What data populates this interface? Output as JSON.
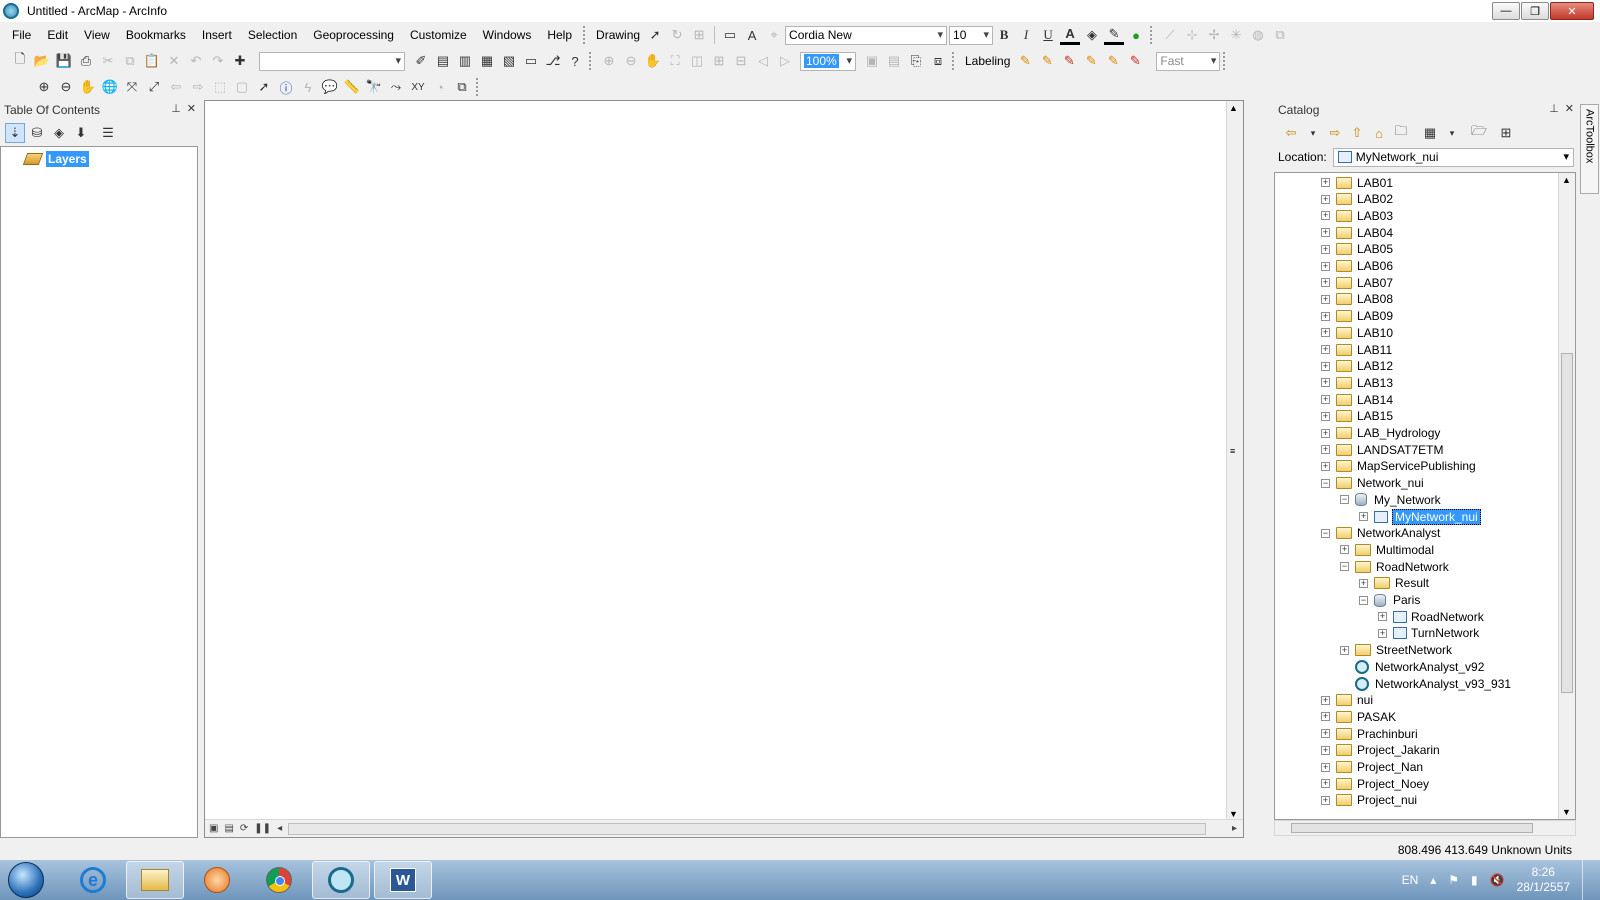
{
  "window": {
    "title": "Untitled - ArcMap - ArcInfo",
    "controls": [
      "—",
      "❐",
      "✕"
    ]
  },
  "menubar": [
    "File",
    "Edit",
    "View",
    "Bookmarks",
    "Insert",
    "Selection",
    "Geoprocessing",
    "Customize",
    "Windows",
    "Help"
  ],
  "drawing_toolbar": {
    "drawing_label": "Drawing",
    "font_name": "Cordia New",
    "font_size": "10",
    "bold": "B",
    "italic": "I",
    "underline": "U",
    "font_color_glyph": "A"
  },
  "standard_toolbar": {
    "scale_value": "",
    "zoom_value": "100%",
    "labeling_label": "Labeling",
    "quality_value": "Fast"
  },
  "toc": {
    "title": "Table Of Contents",
    "root_layer": "Layers"
  },
  "catalog": {
    "title": "Catalog",
    "location_label": "Location:",
    "location_value": "MyNetwork_nui",
    "tree": [
      {
        "label": "LAB01",
        "level": 0,
        "icon": "folder-icon",
        "expand": "+"
      },
      {
        "label": "LAB02",
        "level": 0,
        "icon": "folder-icon",
        "expand": "+"
      },
      {
        "label": "LAB03",
        "level": 0,
        "icon": "folder-icon",
        "expand": "+"
      },
      {
        "label": "LAB04",
        "level": 0,
        "icon": "folder-icon",
        "expand": "+"
      },
      {
        "label": "LAB05",
        "level": 0,
        "icon": "folder-icon",
        "expand": "+"
      },
      {
        "label": "LAB06",
        "level": 0,
        "icon": "folder-icon",
        "expand": "+"
      },
      {
        "label": "LAB07",
        "level": 0,
        "icon": "folder-icon",
        "expand": "+"
      },
      {
        "label": "LAB08",
        "level": 0,
        "icon": "folder-icon",
        "expand": "+"
      },
      {
        "label": "LAB09",
        "level": 0,
        "icon": "folder-icon",
        "expand": "+"
      },
      {
        "label": "LAB10",
        "level": 0,
        "icon": "folder-icon",
        "expand": "+"
      },
      {
        "label": "LAB11",
        "level": 0,
        "icon": "folder-icon",
        "expand": "+"
      },
      {
        "label": "LAB12",
        "level": 0,
        "icon": "folder-icon",
        "expand": "+"
      },
      {
        "label": "LAB13",
        "level": 0,
        "icon": "folder-icon",
        "expand": "+"
      },
      {
        "label": "LAB14",
        "level": 0,
        "icon": "folder-icon",
        "expand": "+"
      },
      {
        "label": "LAB15",
        "level": 0,
        "icon": "folder-icon",
        "expand": "+"
      },
      {
        "label": "LAB_Hydrology",
        "level": 0,
        "icon": "folder-icon",
        "expand": "+"
      },
      {
        "label": "LANDSAT7ETM",
        "level": 0,
        "icon": "folder-icon",
        "expand": "+"
      },
      {
        "label": "MapServicePublishing",
        "level": 0,
        "icon": "folder-icon",
        "expand": "+"
      },
      {
        "label": "Network_nui",
        "level": 0,
        "icon": "folder-icon",
        "expand": "−"
      },
      {
        "label": "My_Network",
        "level": 1,
        "icon": "gdb-icon",
        "expand": "−"
      },
      {
        "label": "MyNetwork_nui",
        "level": 2,
        "icon": "net-icon",
        "expand": "+",
        "selected": true
      },
      {
        "label": "NetworkAnalyst",
        "level": 0,
        "icon": "folder-icon",
        "expand": "−"
      },
      {
        "label": "Multimodal",
        "level": 1,
        "icon": "folder-icon",
        "expand": "+"
      },
      {
        "label": "RoadNetwork",
        "level": 1,
        "icon": "folder-icon",
        "expand": "−"
      },
      {
        "label": "Result",
        "level": 2,
        "icon": "folder-icon",
        "expand": "+"
      },
      {
        "label": "Paris",
        "level": 2,
        "icon": "gdb-icon",
        "expand": "−"
      },
      {
        "label": "RoadNetwork",
        "level": 3,
        "icon": "net-icon",
        "expand": "+"
      },
      {
        "label": "TurnNetwork",
        "level": 3,
        "icon": "net-icon",
        "expand": "+"
      },
      {
        "label": "StreetNetwork",
        "level": 1,
        "icon": "folder-icon",
        "expand": "+"
      },
      {
        "label": "NetworkAnalyst_v92",
        "level": 1,
        "icon": "mxd-icon",
        "expand": ""
      },
      {
        "label": "NetworkAnalyst_v93_931",
        "level": 1,
        "icon": "mxd-icon",
        "expand": ""
      },
      {
        "label": "nui",
        "level": 0,
        "icon": "folder-icon",
        "expand": "+"
      },
      {
        "label": "PASAK",
        "level": 0,
        "icon": "folder-icon",
        "expand": "+"
      },
      {
        "label": "Prachinburi",
        "level": 0,
        "icon": "folder-icon",
        "expand": "+"
      },
      {
        "label": "Project_Jakarin",
        "level": 0,
        "icon": "folder-icon",
        "expand": "+"
      },
      {
        "label": "Project_Nan",
        "level": 0,
        "icon": "folder-icon",
        "expand": "+"
      },
      {
        "label": "Project_Noey",
        "level": 0,
        "icon": "folder-icon",
        "expand": "+"
      },
      {
        "label": "Project_nui",
        "level": 0,
        "icon": "folder-icon",
        "expand": "+"
      }
    ]
  },
  "arctoolbox_tab": "ArcToolbox",
  "status": {
    "coordinates": "808.496  413.649 Unknown Units"
  },
  "taskbar": {
    "apps": [
      "internet-explorer",
      "file-explorer",
      "media-player",
      "chrome",
      "arcmap",
      "word"
    ],
    "language": "EN",
    "time": "8:26",
    "date": "28/1/2557"
  }
}
